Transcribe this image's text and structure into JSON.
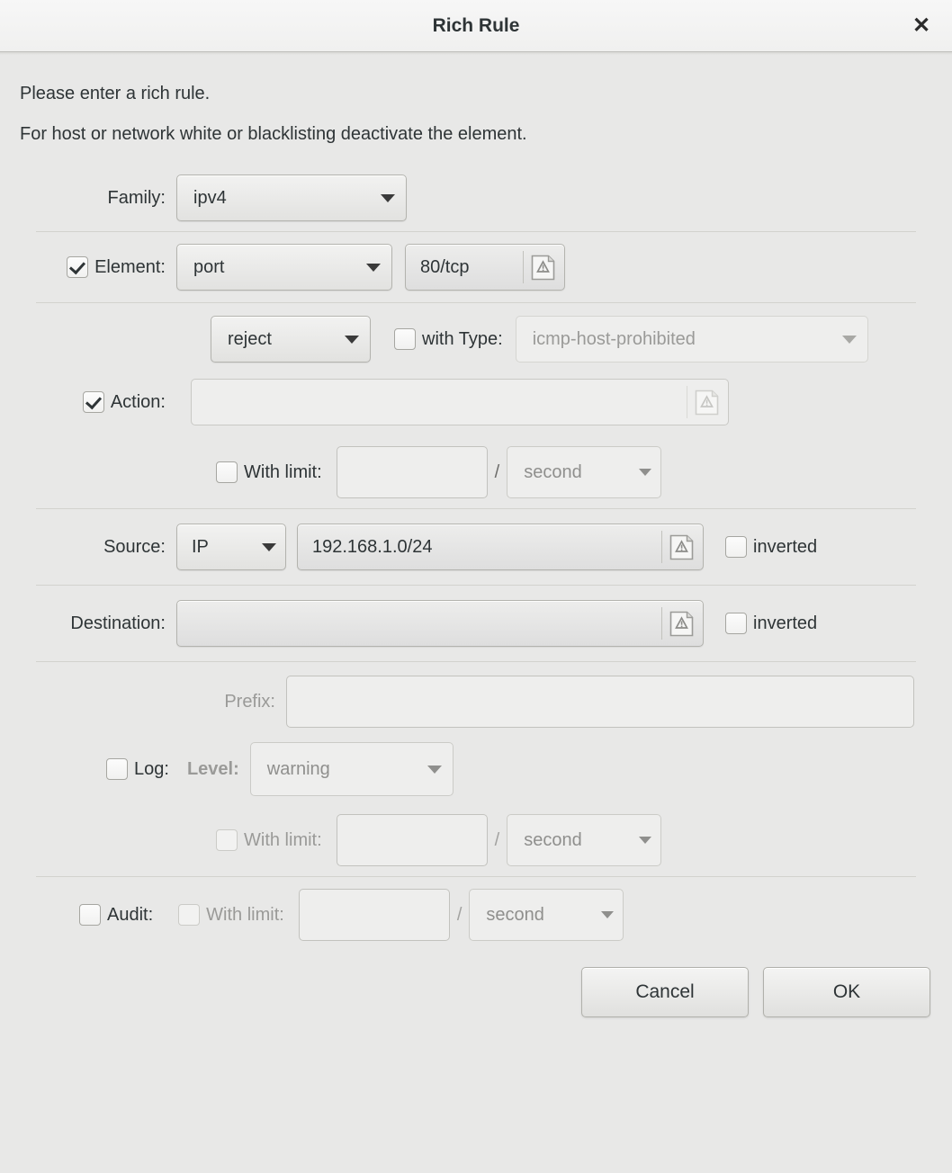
{
  "window": {
    "title": "Rich Rule",
    "close_label": "✕"
  },
  "intro": {
    "line1": "Please enter a rich rule.",
    "line2": "For host or network white or blacklisting deactivate the element."
  },
  "family": {
    "label": "Family:",
    "value": "ipv4"
  },
  "element": {
    "label": "Element:",
    "checked": true,
    "type_value": "port",
    "entry_value": "80/tcp"
  },
  "action": {
    "label": "Action:",
    "checked": true,
    "type_value": "reject",
    "with_type_label": "with Type:",
    "with_type_checked": false,
    "icmp_type_value": "icmp-host-prohibited",
    "entry_value": "",
    "limit_label": "With limit:",
    "limit_checked": false,
    "limit_value": "",
    "limit_separator": "/",
    "limit_unit": "second"
  },
  "source": {
    "label": "Source:",
    "type_value": "IP",
    "value": "192.168.1.0/24",
    "inverted_label": "inverted",
    "inverted_checked": false
  },
  "destination": {
    "label": "Destination:",
    "value": "",
    "inverted_label": "inverted",
    "inverted_checked": false
  },
  "log": {
    "prefix_label": "Prefix:",
    "prefix_value": "",
    "label": "Log:",
    "checked": false,
    "level_label": "Level:",
    "level_value": "warning",
    "limit_label": "With limit:",
    "limit_checked": false,
    "limit_value": "",
    "limit_separator": "/",
    "limit_unit": "second"
  },
  "audit": {
    "label": "Audit:",
    "checked": false,
    "limit_label": "With limit:",
    "limit_checked": false,
    "limit_value": "",
    "limit_separator": "/",
    "limit_unit": "second"
  },
  "footer": {
    "cancel_label": "Cancel",
    "ok_label": "OK"
  },
  "icons": {
    "entry_warning": "warning-page-icon",
    "dropdown": "chevron-down-icon",
    "close": "close-icon"
  },
  "colors": {
    "background": "#e8e8e7",
    "text": "#2e3436",
    "disabled_text": "#9a9a98",
    "border": "#b3b3ae",
    "separator": "#d2d2ce"
  }
}
